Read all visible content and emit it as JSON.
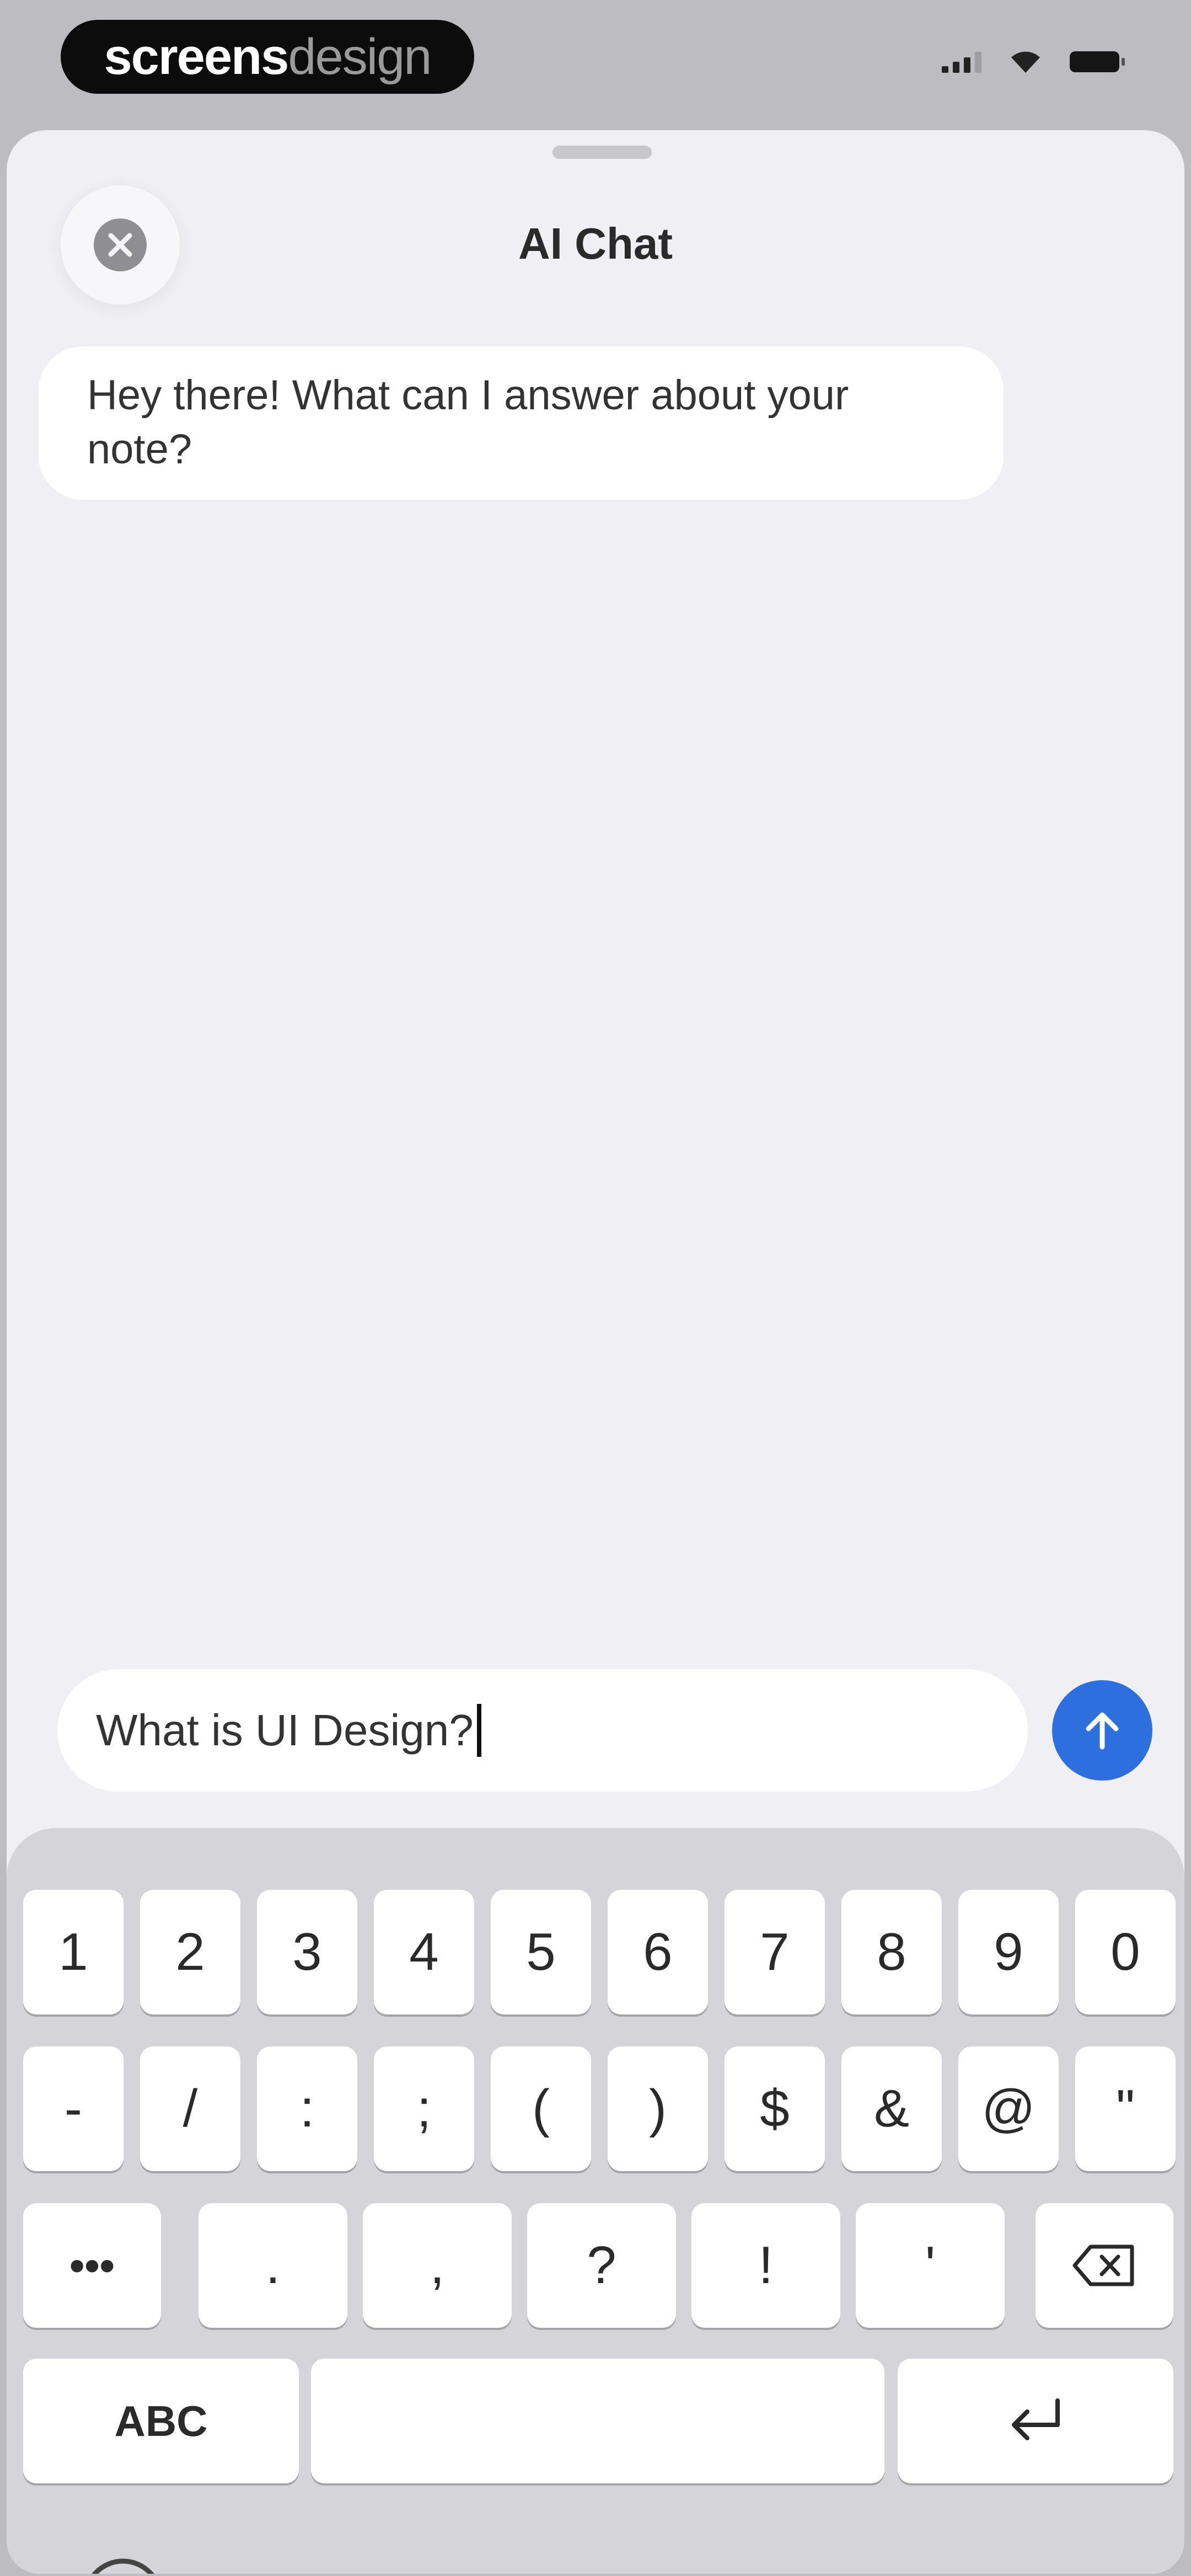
{
  "status_bar": {
    "watermark_bold": "screens",
    "watermark_light": "design"
  },
  "sheet": {
    "title": "AI Chat",
    "messages": [
      {
        "role": "assistant",
        "text": "Hey there! What can I answer about your note?"
      }
    ]
  },
  "composer": {
    "value": "What is UI Design?"
  },
  "keyboard": {
    "row1": [
      "1",
      "2",
      "3",
      "4",
      "5",
      "6",
      "7",
      "8",
      "9",
      "0"
    ],
    "row2": [
      "-",
      "/",
      ":",
      ";",
      "(",
      ")",
      "$",
      "&",
      "@",
      "\""
    ],
    "row3": [
      ".",
      ",",
      "?",
      "!",
      "'"
    ],
    "more_label": "•••",
    "abc_label": "ABC"
  },
  "colors": {
    "accent": "#2e6fe0",
    "sheet_background": "#efeff4",
    "keyboard_background": "#d4d4d9"
  },
  "icons": {
    "close": "close-icon",
    "send": "arrow-up-icon",
    "backspace": "backspace-icon",
    "return": "return-icon",
    "emoji": "emoji-icon"
  }
}
